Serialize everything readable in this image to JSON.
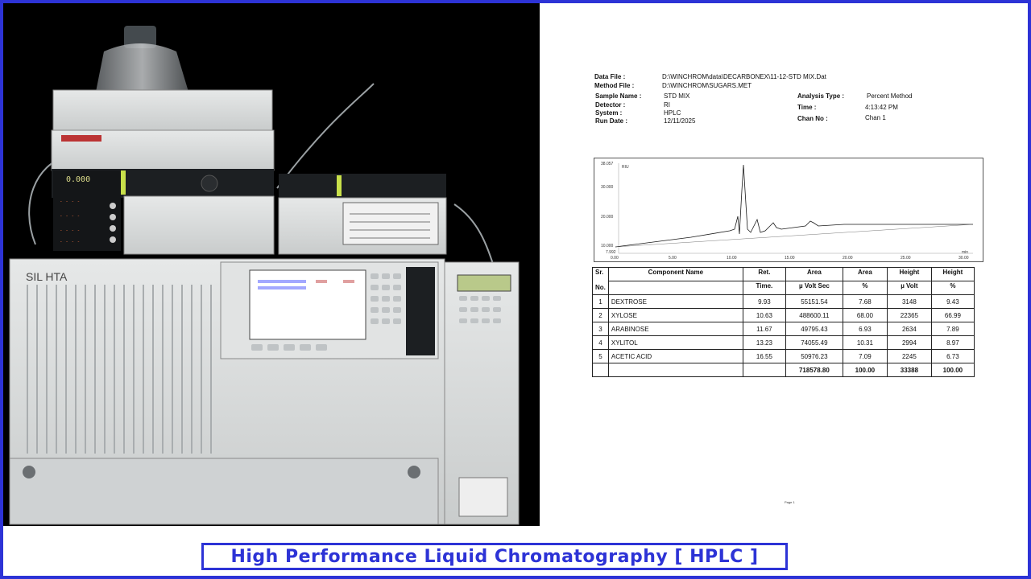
{
  "report": {
    "data_file_label": "Data File :",
    "data_file_value": "D:\\WINCHROM\\data\\DECARBONEX\\11-12-STD MIX.Dat",
    "method_file_label": "Method File :",
    "method_file_value": "D:\\WINCHROM\\SUGARS.MET",
    "sample_name_label": "Sample Name :",
    "sample_name_value": "STD MIX",
    "detector_label": "Detector :",
    "detector_value": "RI",
    "system_label": "System :",
    "system_value": "HPLC",
    "run_date_label": "Run Date :",
    "run_date_value": "12/11/2025",
    "analysis_type_label": "Analysis Type :",
    "analysis_type_value": "Percent Method",
    "time_label": "Time :",
    "time_value": "4:13:42 PM",
    "chan_label": "Chan No :",
    "chan_value": "Chan 1",
    "page_number": "Page 1"
  },
  "chromatogram": {
    "y_unit": "RIU",
    "x_unit": "min",
    "y_ticks": [
      "38.057",
      "30.000",
      "20.000",
      "10.000",
      "7.992"
    ],
    "x_ticks": [
      "0.00",
      "5.00",
      "10.00",
      "15.00",
      "20.00",
      "25.00",
      "30.00"
    ]
  },
  "table": {
    "headers": {
      "sr": "Sr.",
      "no": "No.",
      "component": "Component Name",
      "ret_1": "Ret.",
      "ret_2": "Time.",
      "area_1": "Area",
      "area_2": "µ Volt Sec",
      "area_pct_1": "Area",
      "area_pct_2": "%",
      "height_1": "Height",
      "height_2": "µ Volt",
      "height_pct_1": "Height",
      "height_pct_2": "%"
    },
    "rows": [
      {
        "no": "1",
        "name": "DEXTROSE",
        "ret": "9.93",
        "area": "55151.54",
        "area_pct": "7.68",
        "height": "3148",
        "height_pct": "9.43"
      },
      {
        "no": "2",
        "name": "XYLOSE",
        "ret": "10.63",
        "area": "488600.11",
        "area_pct": "68.00",
        "height": "22365",
        "height_pct": "66.99"
      },
      {
        "no": "3",
        "name": "ARABINOSE",
        "ret": "11.67",
        "area": "49795.43",
        "area_pct": "6.93",
        "height": "2634",
        "height_pct": "7.89"
      },
      {
        "no": "4",
        "name": "XYLITOL",
        "ret": "13.23",
        "area": "74055.49",
        "area_pct": "10.31",
        "height": "2994",
        "height_pct": "8.97"
      },
      {
        "no": "5",
        "name": "ACETIC ACID",
        "ret": "16.55",
        "area": "50976.23",
        "area_pct": "7.09",
        "height": "2245",
        "height_pct": "6.73"
      }
    ],
    "totals": {
      "area": "718578.80",
      "area_pct": "100.00",
      "height": "33388",
      "height_pct": "100.00"
    }
  },
  "instrument": {
    "brand_label": "SIL HTA",
    "screen_text": "---"
  },
  "caption": {
    "text": "High Performance Liquid Chromatography [ HPLC ]"
  },
  "colors": {
    "accent": "#2d33d6",
    "instrument_body": "#d9dbdb",
    "lcd_green": "#b9c98a"
  }
}
